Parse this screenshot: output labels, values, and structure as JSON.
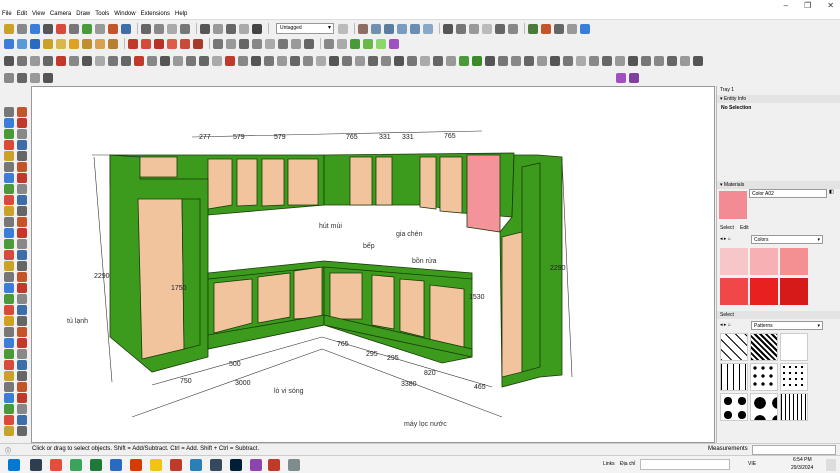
{
  "menu": [
    "File",
    "Edit",
    "View",
    "Camera",
    "Draw",
    "Tools",
    "Window",
    "Extensions",
    "Help"
  ],
  "layer": "Untagged",
  "window_controls": [
    "–",
    "❐",
    "✕"
  ],
  "viewport": {
    "dimensions": {
      "top1": "277",
      "top2": "579",
      "top3": "579",
      "top4": "765",
      "top5": "331",
      "top6": "331",
      "top7": "765",
      "left_height": "2290",
      "right_height": "2290",
      "inner_left_height": "1750",
      "inner_right_height": "1530",
      "base1": "750",
      "base2": "500",
      "base3": "3000",
      "base4": "765",
      "base5": "295",
      "base6": "295",
      "base7": "820",
      "base8": "465",
      "base9": "3380"
    },
    "labels": {
      "fridge": "tủ lạnh",
      "hood": "hút mùi",
      "spice": "gia chén",
      "stove": "bếp",
      "sink": "bồn rửa",
      "microwave": "lò vi sóng",
      "purifier": "máy lọc nước"
    },
    "colors": {
      "carcass": "#3c9a1c",
      "panel": "#f2c49e",
      "door": "#f4949a",
      "edge": "#1a3b0a"
    }
  },
  "tray": {
    "title": "Tray 1",
    "entity_info": {
      "header": "Entity Info",
      "status": "No Selection"
    },
    "materials": {
      "header": "Materials",
      "current_name": "Color A02",
      "current_color": "#f28b93",
      "tabs": [
        "Select",
        "Edit"
      ],
      "library": "Colors",
      "swatches": [
        "#f7c6c8",
        "#f7b0b3",
        "#f48f92",
        "#f04848",
        "#e82020",
        "#d61a1a"
      ]
    },
    "select": {
      "header": "Select",
      "library": "Patterns"
    }
  },
  "status": {
    "hint": "Click or drag to select objects. Shift = Add/Subtract. Ctrl = Add. Shift + Ctrl = Subtract.",
    "measurements_label": "Measurements"
  },
  "taskbar": {
    "links": "Links",
    "address": "Địa chỉ",
    "lang": "VIE",
    "time": "6:54 PM",
    "date": "29/3/2024"
  }
}
